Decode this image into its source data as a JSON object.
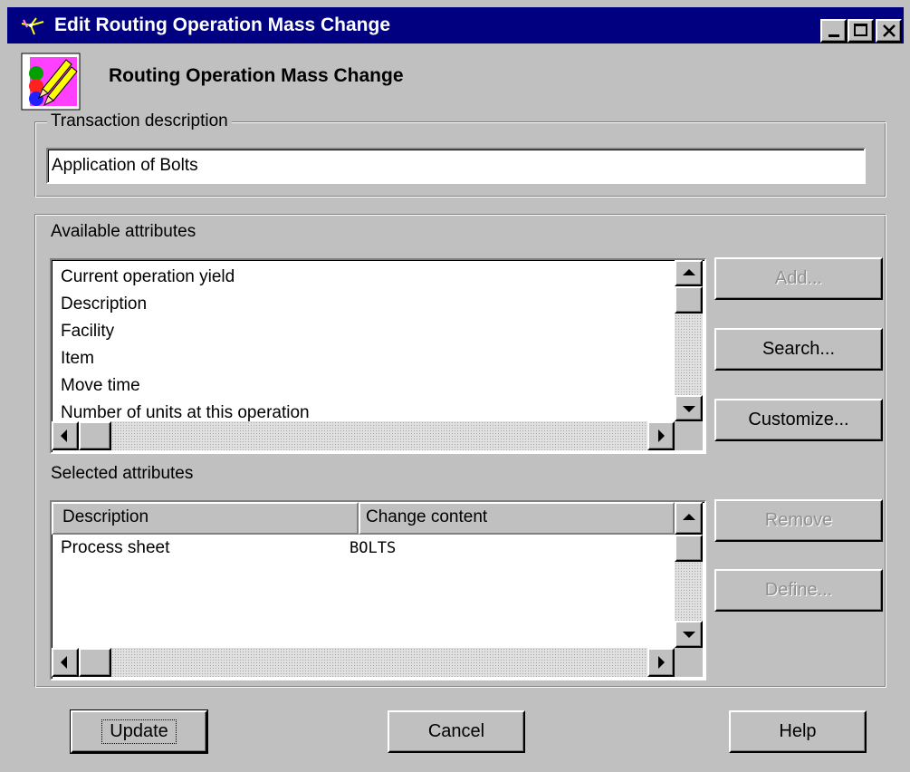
{
  "window": {
    "title": "Edit Routing Operation Mass Change",
    "header_title": "Routing Operation Mass Change"
  },
  "transaction": {
    "legend": "Transaction description",
    "value": "Application of Bolts"
  },
  "available": {
    "label": "Available attributes",
    "items": [
      "Current operation yield",
      "Description",
      "Facility",
      "Item",
      "Move time",
      "Number of units at this operation"
    ]
  },
  "selected": {
    "label": "Selected attributes",
    "columns": [
      "Description",
      "Change content"
    ],
    "rows": [
      {
        "description": "Process sheet",
        "content": "BOLTS"
      }
    ]
  },
  "buttons": {
    "add": "Add...",
    "search": "Search...",
    "customize": "Customize...",
    "remove": "Remove",
    "define": "Define...",
    "update": "Update",
    "cancel": "Cancel",
    "help": "Help"
  },
  "colors": {
    "title_bar": "#000080",
    "face": "#c0c0c0"
  },
  "icons": {
    "title": "routing-logo-icon",
    "app": "mass-change-pencils-icon",
    "minimize": "minimize-icon",
    "maximize": "maximize-icon",
    "close": "close-icon"
  }
}
